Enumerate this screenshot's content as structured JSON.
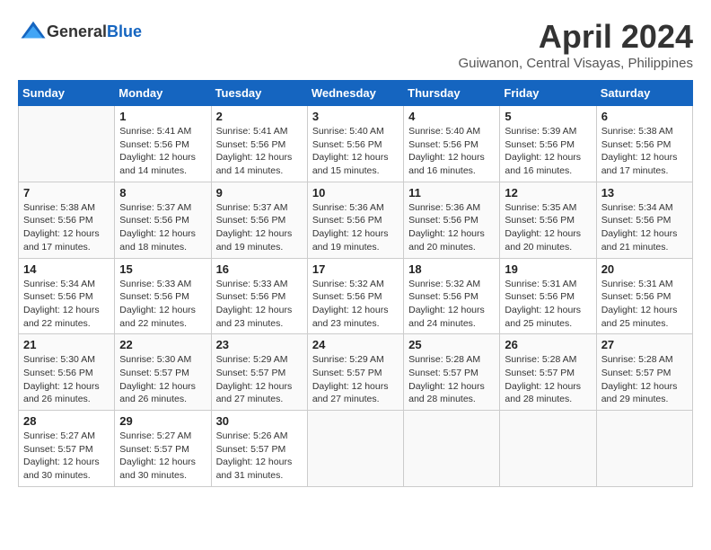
{
  "header": {
    "logo_general": "General",
    "logo_blue": "Blue",
    "month_title": "April 2024",
    "location": "Guiwanon, Central Visayas, Philippines"
  },
  "weekdays": [
    "Sunday",
    "Monday",
    "Tuesday",
    "Wednesday",
    "Thursday",
    "Friday",
    "Saturday"
  ],
  "weeks": [
    [
      {
        "day": "",
        "sunrise": "",
        "sunset": "",
        "daylight": ""
      },
      {
        "day": "1",
        "sunrise": "Sunrise: 5:41 AM",
        "sunset": "Sunset: 5:56 PM",
        "daylight": "Daylight: 12 hours and 14 minutes."
      },
      {
        "day": "2",
        "sunrise": "Sunrise: 5:41 AM",
        "sunset": "Sunset: 5:56 PM",
        "daylight": "Daylight: 12 hours and 14 minutes."
      },
      {
        "day": "3",
        "sunrise": "Sunrise: 5:40 AM",
        "sunset": "Sunset: 5:56 PM",
        "daylight": "Daylight: 12 hours and 15 minutes."
      },
      {
        "day": "4",
        "sunrise": "Sunrise: 5:40 AM",
        "sunset": "Sunset: 5:56 PM",
        "daylight": "Daylight: 12 hours and 16 minutes."
      },
      {
        "day": "5",
        "sunrise": "Sunrise: 5:39 AM",
        "sunset": "Sunset: 5:56 PM",
        "daylight": "Daylight: 12 hours and 16 minutes."
      },
      {
        "day": "6",
        "sunrise": "Sunrise: 5:38 AM",
        "sunset": "Sunset: 5:56 PM",
        "daylight": "Daylight: 12 hours and 17 minutes."
      }
    ],
    [
      {
        "day": "7",
        "sunrise": "Sunrise: 5:38 AM",
        "sunset": "Sunset: 5:56 PM",
        "daylight": "Daylight: 12 hours and 17 minutes."
      },
      {
        "day": "8",
        "sunrise": "Sunrise: 5:37 AM",
        "sunset": "Sunset: 5:56 PM",
        "daylight": "Daylight: 12 hours and 18 minutes."
      },
      {
        "day": "9",
        "sunrise": "Sunrise: 5:37 AM",
        "sunset": "Sunset: 5:56 PM",
        "daylight": "Daylight: 12 hours and 19 minutes."
      },
      {
        "day": "10",
        "sunrise": "Sunrise: 5:36 AM",
        "sunset": "Sunset: 5:56 PM",
        "daylight": "Daylight: 12 hours and 19 minutes."
      },
      {
        "day": "11",
        "sunrise": "Sunrise: 5:36 AM",
        "sunset": "Sunset: 5:56 PM",
        "daylight": "Daylight: 12 hours and 20 minutes."
      },
      {
        "day": "12",
        "sunrise": "Sunrise: 5:35 AM",
        "sunset": "Sunset: 5:56 PM",
        "daylight": "Daylight: 12 hours and 20 minutes."
      },
      {
        "day": "13",
        "sunrise": "Sunrise: 5:34 AM",
        "sunset": "Sunset: 5:56 PM",
        "daylight": "Daylight: 12 hours and 21 minutes."
      }
    ],
    [
      {
        "day": "14",
        "sunrise": "Sunrise: 5:34 AM",
        "sunset": "Sunset: 5:56 PM",
        "daylight": "Daylight: 12 hours and 22 minutes."
      },
      {
        "day": "15",
        "sunrise": "Sunrise: 5:33 AM",
        "sunset": "Sunset: 5:56 PM",
        "daylight": "Daylight: 12 hours and 22 minutes."
      },
      {
        "day": "16",
        "sunrise": "Sunrise: 5:33 AM",
        "sunset": "Sunset: 5:56 PM",
        "daylight": "Daylight: 12 hours and 23 minutes."
      },
      {
        "day": "17",
        "sunrise": "Sunrise: 5:32 AM",
        "sunset": "Sunset: 5:56 PM",
        "daylight": "Daylight: 12 hours and 23 minutes."
      },
      {
        "day": "18",
        "sunrise": "Sunrise: 5:32 AM",
        "sunset": "Sunset: 5:56 PM",
        "daylight": "Daylight: 12 hours and 24 minutes."
      },
      {
        "day": "19",
        "sunrise": "Sunrise: 5:31 AM",
        "sunset": "Sunset: 5:56 PM",
        "daylight": "Daylight: 12 hours and 25 minutes."
      },
      {
        "day": "20",
        "sunrise": "Sunrise: 5:31 AM",
        "sunset": "Sunset: 5:56 PM",
        "daylight": "Daylight: 12 hours and 25 minutes."
      }
    ],
    [
      {
        "day": "21",
        "sunrise": "Sunrise: 5:30 AM",
        "sunset": "Sunset: 5:56 PM",
        "daylight": "Daylight: 12 hours and 26 minutes."
      },
      {
        "day": "22",
        "sunrise": "Sunrise: 5:30 AM",
        "sunset": "Sunset: 5:57 PM",
        "daylight": "Daylight: 12 hours and 26 minutes."
      },
      {
        "day": "23",
        "sunrise": "Sunrise: 5:29 AM",
        "sunset": "Sunset: 5:57 PM",
        "daylight": "Daylight: 12 hours and 27 minutes."
      },
      {
        "day": "24",
        "sunrise": "Sunrise: 5:29 AM",
        "sunset": "Sunset: 5:57 PM",
        "daylight": "Daylight: 12 hours and 27 minutes."
      },
      {
        "day": "25",
        "sunrise": "Sunrise: 5:28 AM",
        "sunset": "Sunset: 5:57 PM",
        "daylight": "Daylight: 12 hours and 28 minutes."
      },
      {
        "day": "26",
        "sunrise": "Sunrise: 5:28 AM",
        "sunset": "Sunset: 5:57 PM",
        "daylight": "Daylight: 12 hours and 28 minutes."
      },
      {
        "day": "27",
        "sunrise": "Sunrise: 5:28 AM",
        "sunset": "Sunset: 5:57 PM",
        "daylight": "Daylight: 12 hours and 29 minutes."
      }
    ],
    [
      {
        "day": "28",
        "sunrise": "Sunrise: 5:27 AM",
        "sunset": "Sunset: 5:57 PM",
        "daylight": "Daylight: 12 hours and 30 minutes."
      },
      {
        "day": "29",
        "sunrise": "Sunrise: 5:27 AM",
        "sunset": "Sunset: 5:57 PM",
        "daylight": "Daylight: 12 hours and 30 minutes."
      },
      {
        "day": "30",
        "sunrise": "Sunrise: 5:26 AM",
        "sunset": "Sunset: 5:57 PM",
        "daylight": "Daylight: 12 hours and 31 minutes."
      },
      {
        "day": "",
        "sunrise": "",
        "sunset": "",
        "daylight": ""
      },
      {
        "day": "",
        "sunrise": "",
        "sunset": "",
        "daylight": ""
      },
      {
        "day": "",
        "sunrise": "",
        "sunset": "",
        "daylight": ""
      },
      {
        "day": "",
        "sunrise": "",
        "sunset": "",
        "daylight": ""
      }
    ]
  ]
}
